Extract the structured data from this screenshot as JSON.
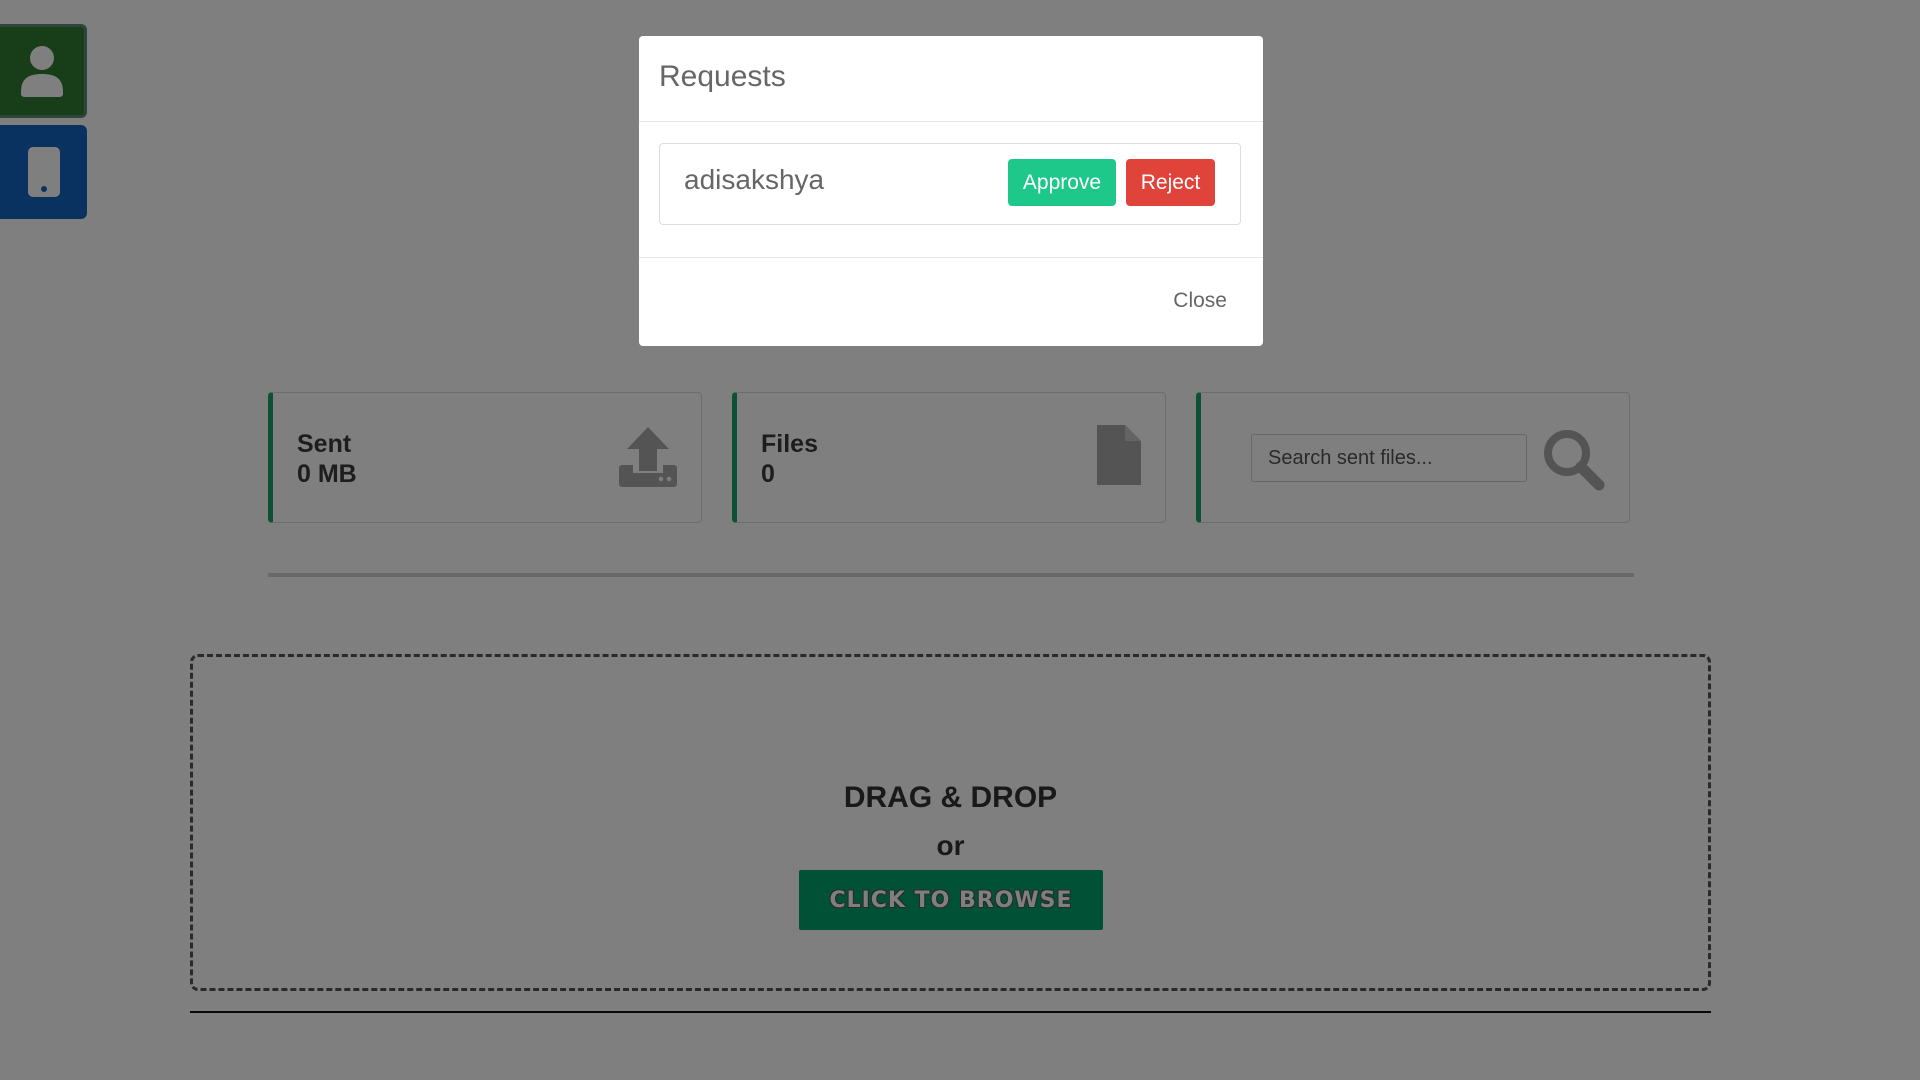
{
  "sidebar": {
    "buttons": [
      {
        "icon": "user-icon",
        "color": "#2e7d32"
      },
      {
        "icon": "mobile-device-icon",
        "color": "#1565c0"
      }
    ]
  },
  "stats": {
    "sent": {
      "label": "Sent",
      "value": "0 MB",
      "icon": "upload-icon"
    },
    "files": {
      "label": "Files",
      "value": "0",
      "icon": "file-icon"
    },
    "search": {
      "placeholder": "Search sent files...",
      "value": "",
      "icon": "search-icon"
    }
  },
  "dropzone": {
    "title": "DRAG & DROP",
    "or": "or",
    "browse_label": "CLICK TO BROWSE"
  },
  "modal": {
    "title": "Requests",
    "requests": [
      {
        "name": "adisakshya",
        "approve_label": "Approve",
        "reject_label": "Reject"
      }
    ],
    "close_label": "Close"
  },
  "colors": {
    "accent": "#1aa36b",
    "approve": "#1ec88a",
    "reject": "#e0433a",
    "browse": "#00a36c"
  }
}
